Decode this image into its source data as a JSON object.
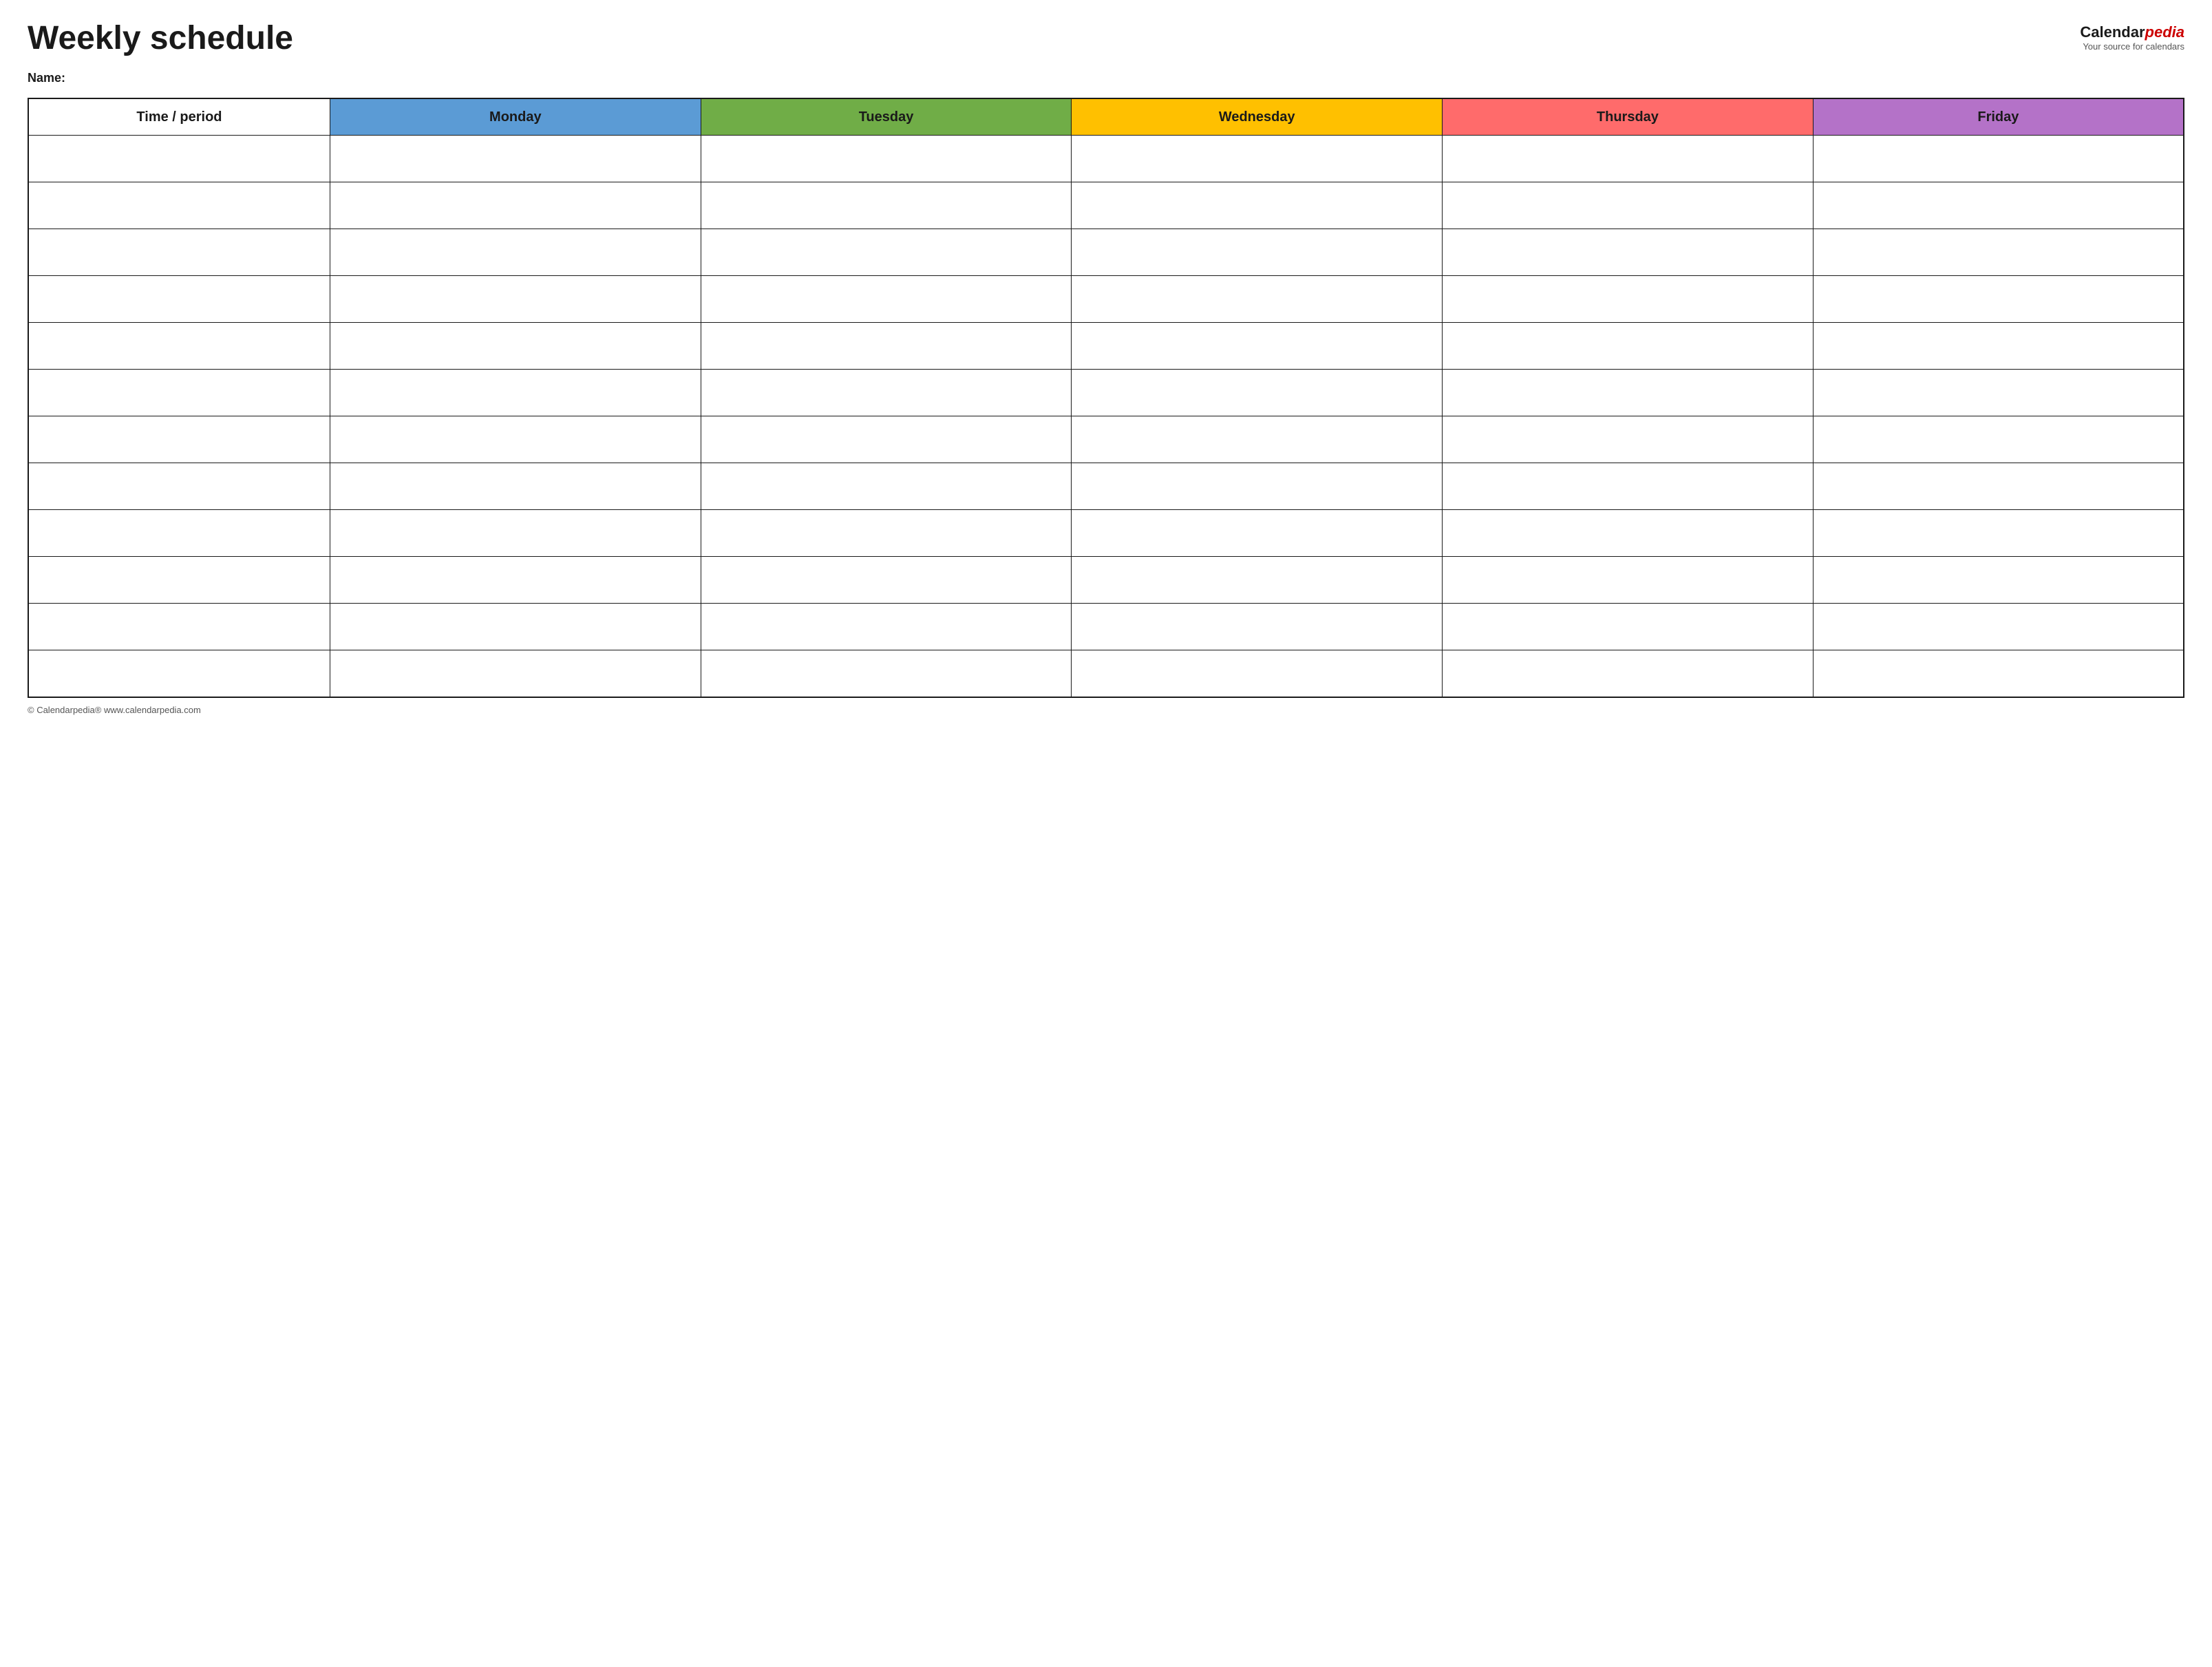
{
  "header": {
    "title": "Weekly schedule",
    "logo": {
      "calendar_part": "Calendar",
      "pedia_part": "pedia",
      "tagline": "Your source for calendars"
    }
  },
  "name_section": {
    "label": "Name:"
  },
  "table": {
    "columns": [
      {
        "id": "time",
        "label": "Time / period",
        "color": "#ffffff"
      },
      {
        "id": "monday",
        "label": "Monday",
        "color": "#5b9bd5"
      },
      {
        "id": "tuesday",
        "label": "Tuesday",
        "color": "#70ad47"
      },
      {
        "id": "wednesday",
        "label": "Wednesday",
        "color": "#ffc000"
      },
      {
        "id": "thursday",
        "label": "Thursday",
        "color": "#ff6b6b"
      },
      {
        "id": "friday",
        "label": "Friday",
        "color": "#b472c8"
      }
    ],
    "row_count": 12
  },
  "footer": {
    "text": "© Calendarpedia®  www.calendarpedia.com"
  }
}
